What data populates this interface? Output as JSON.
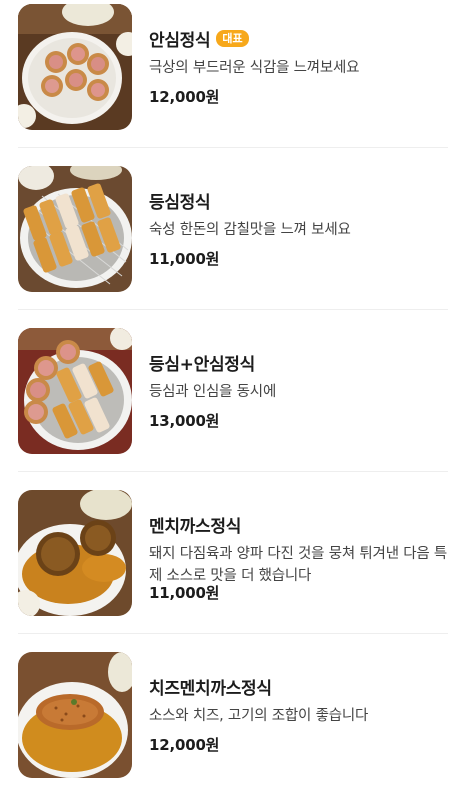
{
  "menu": {
    "items": [
      {
        "name": "안심정식",
        "badge": "대표",
        "description": "극상의 부드러운 식감을 느껴보세요",
        "price": "12,000원",
        "photo_icon": "tonkatsu-tenderloin-photo"
      },
      {
        "name": "등심정식",
        "badge": "",
        "description": "숙성 한돈의 감칠맛을 느껴 보세요",
        "price": "11,000원",
        "photo_icon": "tonkatsu-loin-photo"
      },
      {
        "name": "등심+안심정식",
        "badge": "",
        "description": "등심과 인심을 동시에",
        "price": "13,000원",
        "photo_icon": "tonkatsu-combo-photo"
      },
      {
        "name": "멘치까스정식",
        "badge": "",
        "description": "돼지 다짐육과 양파 다진 것을 뭉쳐 튀겨낸 다음 특제 소스로 맛을 더 했습니다",
        "price": "11,000원",
        "photo_icon": "menchi-katsu-photo"
      },
      {
        "name": "치즈멘치까스정식",
        "badge": "",
        "description": "소스와 치즈, 고기의 조합이 좋습니다",
        "price": "12,000원",
        "photo_icon": "cheese-menchi-katsu-photo"
      }
    ]
  },
  "colors": {
    "badge": "#f7a81b",
    "divider": "#eeeeee",
    "text_primary": "#1c1c1c",
    "text_secondary": "#444444"
  }
}
